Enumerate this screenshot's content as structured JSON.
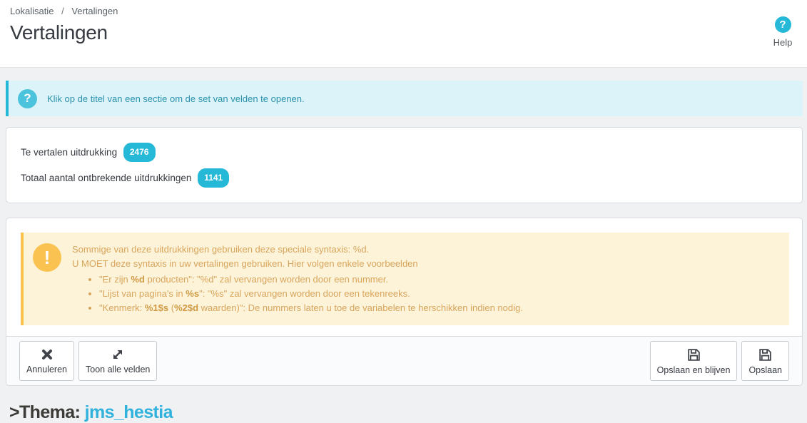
{
  "header": {
    "breadcrumb": {
      "parent": "Lokalisatie",
      "separator": "/",
      "current": "Vertalingen"
    },
    "title": "Vertalingen",
    "help_icon_glyph": "?",
    "help_label": "Help"
  },
  "info_alert": {
    "icon_glyph": "?",
    "text": "Klik op de titel van een sectie om de set van velden te openen."
  },
  "stats": {
    "rows": [
      {
        "label": "Te vertalen uitdrukking",
        "badge": "2476"
      },
      {
        "label": "Totaal aantal ontbrekende uitdrukkingen",
        "badge": "1141"
      }
    ]
  },
  "warning": {
    "icon_glyph": "!",
    "line1": "Sommige van deze uitdrukkingen gebruiken deze speciale syntaxis: %d.",
    "line2": "U MOET deze syntaxis in uw vertalingen gebruiken. Hier volgen enkele voorbeelden",
    "bullets": [
      {
        "s0": "\"Er zijn ",
        "s1": "%d",
        "s2": " producten\": \"%d\" zal vervangen worden door een nummer."
      },
      {
        "s0": "\"Lijst van pagina's in ",
        "s1": "%s",
        "s2": "\": \"%s\" zal vervangen worden door een tekenreeks."
      },
      {
        "s0": "\"Kenmerk: ",
        "s1": "%1$s",
        "s2": " (",
        "s3": "%2$d",
        "s4": " waarden)\": De nummers laten u toe de variabelen te herschikken indien nodig."
      }
    ]
  },
  "footer": {
    "cancel": "Annuleren",
    "show_all": "Toon alle velden",
    "save_stay": "Opslaan en blijven",
    "save": "Opslaan"
  },
  "section": {
    "prefix": ">Thema: ",
    "theme_name": "jms_hestia"
  },
  "colors": {
    "accent": "#25b9d7",
    "info_bg": "#dcf4f9",
    "info_text": "#2c92ad",
    "warning_bg": "#fdf3d9",
    "warning_accent": "#fac14e",
    "warning_text": "#d8a55c",
    "badge_bg": "#25b9d7",
    "theme_link": "#30b2dd"
  }
}
